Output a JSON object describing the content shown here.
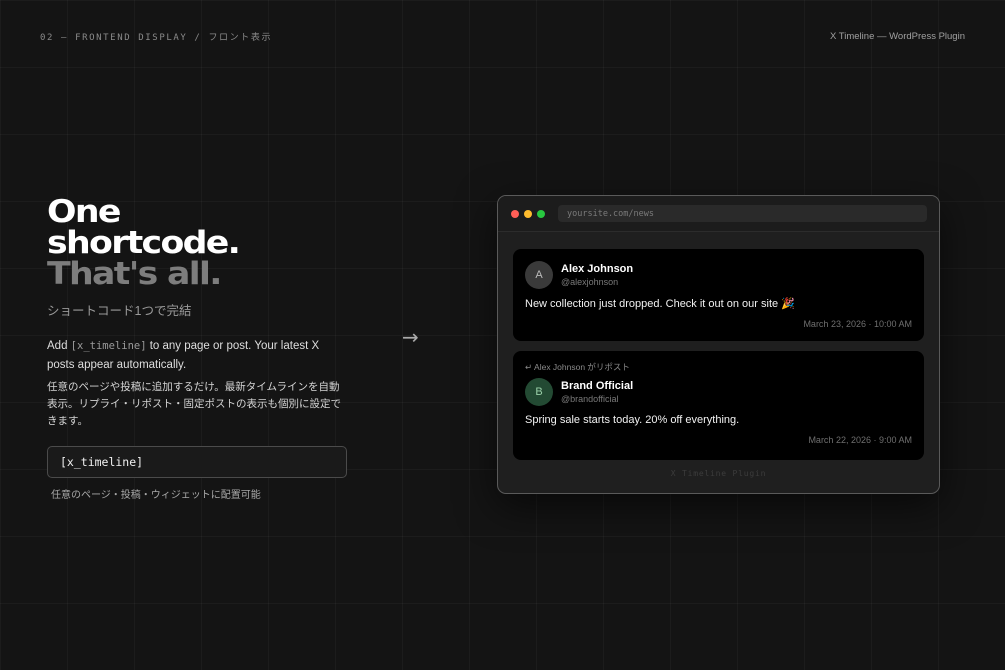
{
  "header": {
    "eyebrow": "02 — FRONTEND DISPLAY / フロント表示",
    "product": "X Timeline — WordPress Plugin"
  },
  "hero": {
    "line1": "One",
    "line2": "shortcode.",
    "line3": "That's all.",
    "subtitle_jp": "ショートコード1つで完結",
    "desc_before": "Add ",
    "desc_code": "[x_timeline]",
    "desc_after": " to any page or post. Your latest X posts appear automatically.",
    "desc_jp": "任意のページや投稿に追加するだけ。最新タイムラインを自動表示。リプライ・リポスト・固定ポストの表示も個別に設定できます。",
    "shortcode": "[x_timeline]",
    "shortcode_caption": "任意のページ・投稿・ウィジェットに配置可能"
  },
  "arrow": "→",
  "browser": {
    "url": "yoursite.com/news",
    "posts": [
      {
        "avatar": "A",
        "name": "Alex Johnson",
        "handle": "@alexjohnson",
        "text": "New collection just dropped. Check it out on our site 🎉",
        "time": "March 23, 2026 · 10:00 AM"
      },
      {
        "repost_icon": "↵",
        "repost": "Alex Johnson がリポスト",
        "avatar": "B",
        "name": "Brand Official",
        "handle": "@brandofficial",
        "text": "Spring sale starts today. 20% off everything.",
        "time": "March 22, 2026 · 9:00 AM"
      }
    ],
    "footer": "X Timeline Plugin"
  },
  "colors": {
    "background": "#141414",
    "dot_red": "#ff5f57",
    "dot_yellow": "#febc2e",
    "dot_green": "#28c840",
    "avatar_green": "#234a33"
  }
}
